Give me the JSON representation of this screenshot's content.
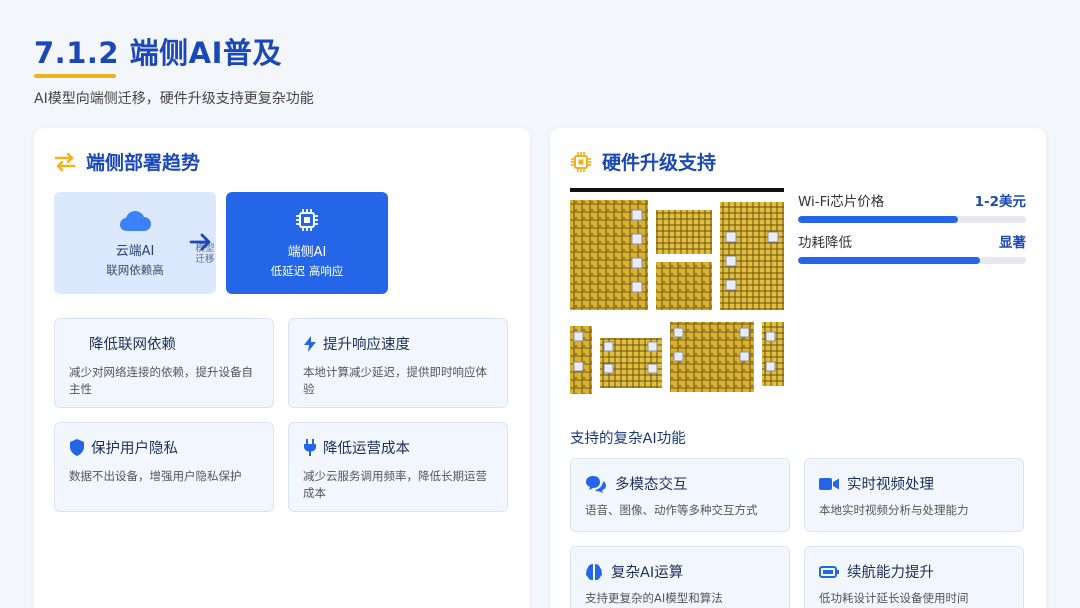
{
  "page": {
    "title": "7.1.2 端侧AI普及",
    "subtitle": "AI模型向端侧迁移，硬件升级支持更复杂功能",
    "accent": "#1b48b8",
    "underline_color": "#f2b21c"
  },
  "left": {
    "heading": "端侧部署趋势",
    "cloud": {
      "name": "云端AI",
      "desc": "联网依赖高"
    },
    "edge": {
      "name": "端侧AI",
      "desc": "低延迟 高响应"
    },
    "arrow_label_1": "模型",
    "arrow_label_2": "迁移",
    "benefits": [
      {
        "icon": "link-icon",
        "title": "降低联网依赖",
        "desc": "减少对网络连接的依赖，提升设备自主性"
      },
      {
        "icon": "bolt-icon",
        "title": "提升响应速度",
        "desc": "本地计算减少延迟，提供即时响应体验"
      },
      {
        "icon": "shield-icon",
        "title": "保护用户隐私",
        "desc": "数据不出设备，增强用户隐私保护"
      },
      {
        "icon": "plug-icon",
        "title": "降低运营成本",
        "desc": "减少云服务调用频率，降低长期运营成本"
      }
    ]
  },
  "right": {
    "heading": "硬件升级支持",
    "metrics": [
      {
        "label": "Wi-Fi芯片价格",
        "value": "1-2美元",
        "fill_percent": 70
      },
      {
        "label": "功耗降低",
        "value": "显著",
        "fill_percent": 80
      }
    ],
    "section_title": "支持的复杂AI功能",
    "features": [
      {
        "icon": "chat-icon",
        "title": "多模态交互",
        "desc": "语音、图像、动作等多种交互方式"
      },
      {
        "icon": "video-camera-icon",
        "title": "实时视频处理",
        "desc": "本地实时视频分析与处理能力"
      },
      {
        "icon": "brain-icon",
        "title": "复杂AI运算",
        "desc": "支持更复杂的AI模型和算法"
      },
      {
        "icon": "battery-icon",
        "title": "续航能力提升",
        "desc": "低功耗设计延长设备使用时间"
      }
    ]
  }
}
